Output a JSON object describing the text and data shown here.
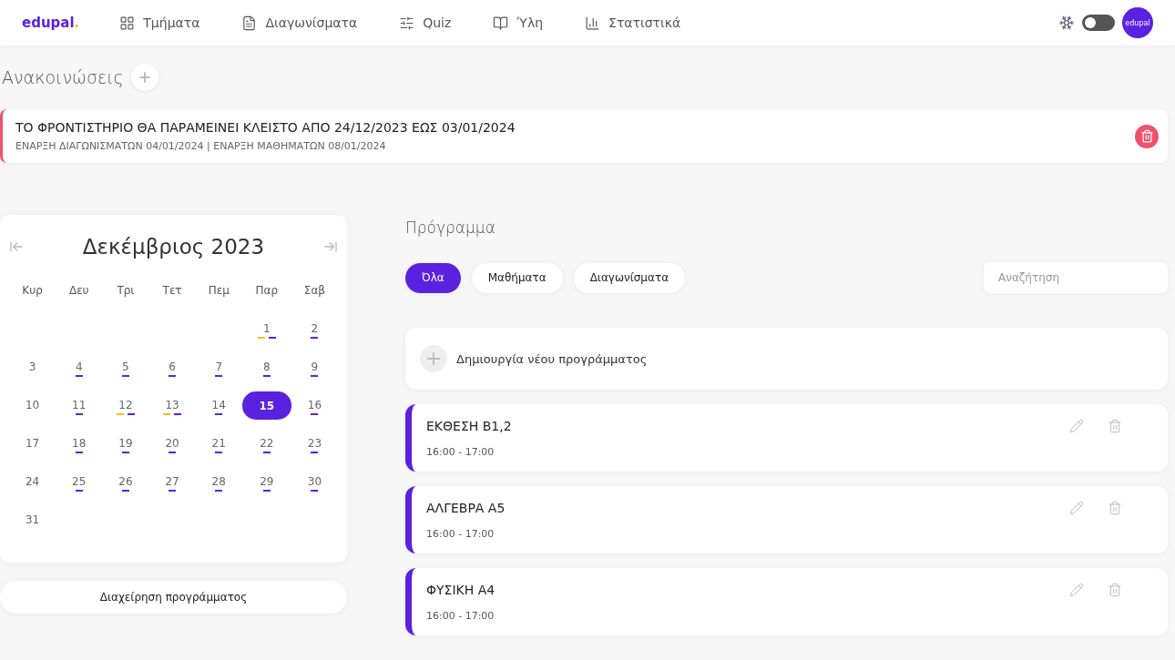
{
  "nav": {
    "logo": "edupal",
    "logo_dot": ".",
    "items": [
      {
        "label": "Τμήματα",
        "kind": "grid"
      },
      {
        "label": "Διαγωνίσματα",
        "kind": "doc"
      },
      {
        "label": "Quiz",
        "kind": "quiz"
      },
      {
        "label": "Ύλη",
        "kind": "book"
      },
      {
        "label": "Στατιστικά",
        "kind": "stats"
      }
    ],
    "theme_toggle": {
      "on": false
    },
    "avatar": "edupal"
  },
  "announcements": {
    "title": "Ανακοινώσεις",
    "items": [
      {
        "title": "ΤΟ ΦΡΟΝΤΙΣΤΗΡΙΟ ΘΑ ΠΑΡΑΜΕΙΝΕΙ ΚΛΕΙΣΤΟ ΑΠΟ 24/12/2023 ΕΩΣ 03/01/2024",
        "subtitle": "ΕΝΑΡΞΗ ΔΙΑΓΩΝΙΣΜΑΤΩΝ 04/01/2024 | ΕΝΑΡΞΗ ΜΑΘΗΜΑΤΩΝ 08/01/2024",
        "color": "#f0506e"
      }
    ]
  },
  "calendar": {
    "month": "Δεκέμβριος 2023",
    "weekdays": [
      "Κυρ",
      "Δευ",
      "Τρι",
      "Τετ",
      "Πεμ",
      "Παρ",
      "Σαβ"
    ],
    "days": [
      {
        "label": "1",
        "selected": false,
        "events": [
          {
            "color": "#f5c518"
          },
          {
            "color": "#5b21e0"
          }
        ]
      },
      {
        "label": "2",
        "selected": false,
        "events": [
          {
            "color": "#5b21e0"
          }
        ]
      },
      {
        "label": "3",
        "selected": false
      },
      {
        "label": "4",
        "selected": false,
        "events": [
          {
            "color": "#5b21e0"
          }
        ]
      },
      {
        "label": "5",
        "selected": false,
        "events": [
          {
            "color": "#5b21e0"
          }
        ]
      },
      {
        "label": "6",
        "selected": false,
        "events": [
          {
            "color": "#5b21e0"
          }
        ]
      },
      {
        "label": "7",
        "selected": false,
        "events": [
          {
            "color": "#5b21e0"
          }
        ]
      },
      {
        "label": "8",
        "selected": false,
        "events": [
          {
            "color": "#5b21e0"
          }
        ]
      },
      {
        "label": "9",
        "selected": false,
        "events": [
          {
            "color": "#5b21e0"
          }
        ]
      },
      {
        "label": "10",
        "selected": false
      },
      {
        "label": "11",
        "selected": false,
        "events": [
          {
            "color": "#5b21e0"
          }
        ]
      },
      {
        "label": "12",
        "selected": false,
        "events": [
          {
            "color": "#f5c518"
          },
          {
            "color": "#5b21e0"
          }
        ]
      },
      {
        "label": "13",
        "selected": false,
        "events": [
          {
            "color": "#f5c518"
          },
          {
            "color": "#5b21e0"
          }
        ]
      },
      {
        "label": "14",
        "selected": false,
        "events": [
          {
            "color": "#5b21e0"
          }
        ]
      },
      {
        "label": "15",
        "selected": true
      },
      {
        "label": "16",
        "selected": false,
        "events": [
          {
            "color": "#5b21e0"
          }
        ]
      },
      {
        "label": "17",
        "selected": false
      },
      {
        "label": "18",
        "selected": false,
        "events": [
          {
            "color": "#5b21e0"
          }
        ]
      },
      {
        "label": "19",
        "selected": false,
        "events": [
          {
            "color": "#5b21e0"
          }
        ]
      },
      {
        "label": "20",
        "selected": false,
        "events": [
          {
            "color": "#5b21e0"
          }
        ]
      },
      {
        "label": "21",
        "selected": false,
        "events": [
          {
            "color": "#5b21e0"
          }
        ]
      },
      {
        "label": "22",
        "selected": false,
        "events": [
          {
            "color": "#5b21e0"
          }
        ]
      },
      {
        "label": "23",
        "selected": false,
        "events": [
          {
            "color": "#5b21e0"
          }
        ]
      },
      {
        "label": "24",
        "selected": false
      },
      {
        "label": "25",
        "selected": false,
        "events": [
          {
            "color": "#5b21e0"
          }
        ]
      },
      {
        "label": "26",
        "selected": false,
        "events": [
          {
            "color": "#5b21e0"
          }
        ]
      },
      {
        "label": "27",
        "selected": false,
        "events": [
          {
            "color": "#5b21e0"
          }
        ]
      },
      {
        "label": "28",
        "selected": false,
        "events": [
          {
            "color": "#5b21e0"
          }
        ]
      },
      {
        "label": "29",
        "selected": false,
        "events": [
          {
            "color": "#5b21e0"
          }
        ]
      },
      {
        "label": "30",
        "selected": false,
        "events": [
          {
            "color": "#5b21e0"
          }
        ]
      },
      {
        "label": "31",
        "selected": false
      }
    ],
    "manage_button": "Διαχείρηση προγράμματος"
  },
  "schedule": {
    "title": "Πρόγραμμα",
    "filters": [
      {
        "label": "Όλα",
        "selected": true
      },
      {
        "label": "Μαθήματα",
        "selected": false
      },
      {
        "label": "Διαγωνίσματα",
        "selected": false
      }
    ],
    "search": {
      "placeholder": "Αναζήτηση"
    },
    "create_label": "Δημιουργία νέου προγράμματος",
    "entries": [
      {
        "title": "ΕΚΘΕΣΗ Β1,2",
        "time": "16:00 - 17:00",
        "color": "#5b21e0"
      },
      {
        "title": "ΑΛΓΕΒΡΑ Α5",
        "time": "16:00 - 17:00",
        "color": "#5b21e0"
      },
      {
        "title": "ΦΥΣΙΚΗ Α4",
        "time": "16:00 - 17:00",
        "color": "#5b21e0"
      }
    ]
  }
}
